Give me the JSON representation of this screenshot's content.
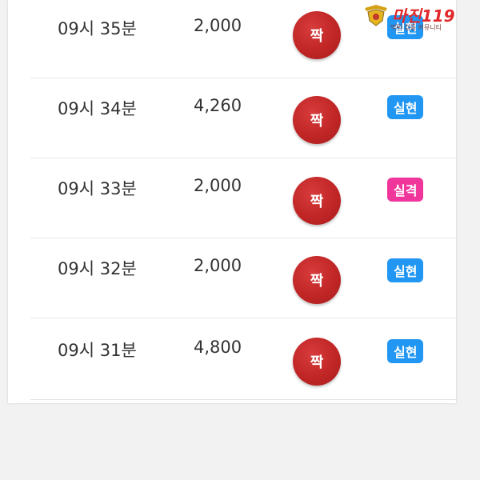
{
  "rows": [
    {
      "time": "09시 35분",
      "amount": "2,000",
      "pick": "짝",
      "result": "실현",
      "result_color": "#2196f3"
    },
    {
      "time": "09시 34분",
      "amount": "4,260",
      "pick": "짝",
      "result": "실현",
      "result_color": "#2196f3"
    },
    {
      "time": "09시 33분",
      "amount": "2,000",
      "pick": "짝",
      "result": "실격",
      "result_color": "#f0359b"
    },
    {
      "time": "09시 32분",
      "amount": "2,000",
      "pick": "짝",
      "result": "실현",
      "result_color": "#2196f3"
    },
    {
      "time": "09시 31분",
      "amount": "4,800",
      "pick": "짝",
      "result": "실현",
      "result_color": "#2196f3"
    }
  ],
  "watermark": {
    "title": "마진119",
    "subtitle": "먹튀 검증 커뮤니티"
  },
  "colors": {
    "ball_red": "#c12626",
    "text": "#333333"
  }
}
